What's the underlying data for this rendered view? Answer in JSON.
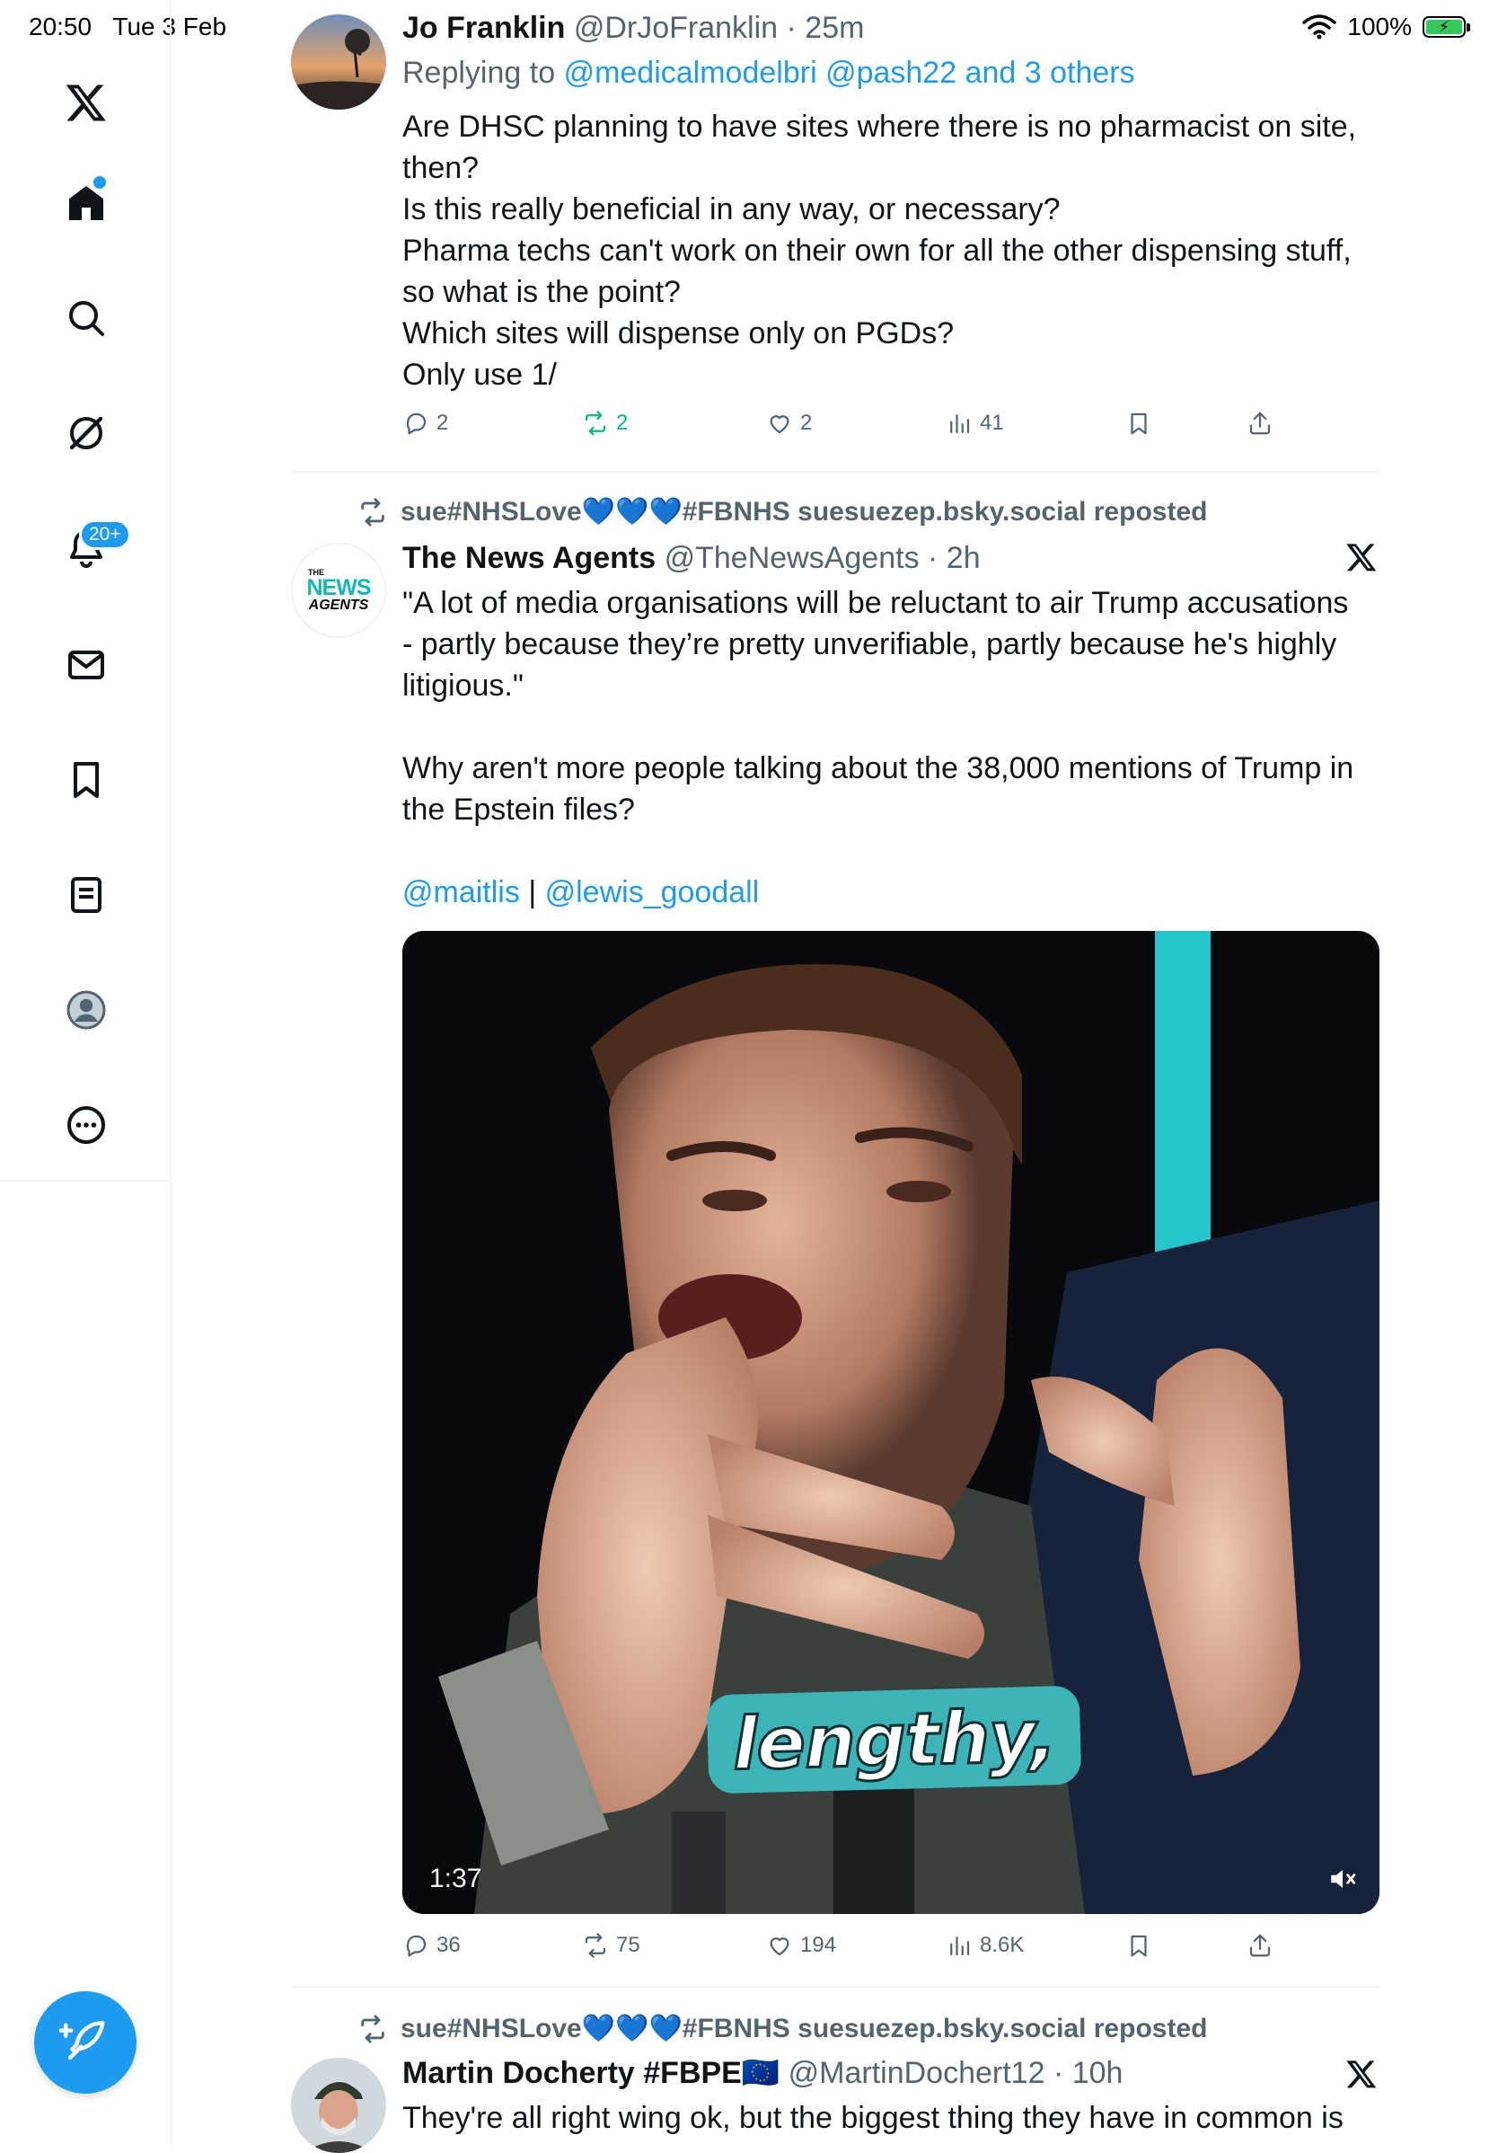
{
  "status_bar": {
    "time": "20:50",
    "date": "Tue 3 Feb",
    "battery": "100%",
    "battery_level_percent": 100
  },
  "sidebar": {
    "notifications_badge": "20+"
  },
  "posts": [
    {
      "name": "Jo Franklin",
      "handle": "@DrJoFranklin",
      "time": "25m",
      "replying_prefix": "Replying to",
      "replying_to": "@medicalmodelbri @pash22 and 3 others",
      "text_lines": [
        "Are DHSC planning to have sites where there is no pharmacist on site,",
        "then?",
        "Is this really beneficial in any way, or necessary?",
        "Pharma techs can't work on their own for all the other dispensing stuff,",
        "so what is the point?",
        "Which sites will dispense only on PGDs?",
        "Only use 1/"
      ],
      "stats": {
        "replies": "2",
        "reposts": "2",
        "likes": "2",
        "views": "41"
      }
    },
    {
      "reposted_by": "sue#NHSLove💙💙💙#FBNHS suesuezep.bsky.social reposted",
      "name": "The News Agents",
      "handle": "@TheNewsAgents",
      "time": "2h",
      "avatar_logo": [
        "THE",
        "NEWS",
        "AGENTS"
      ],
      "text_lines": [
        "\"A lot of media organisations will be reluctant to air Trump accusations",
        "- partly because they’re pretty unverifiable, partly because he's highly",
        "litigious.\"",
        "",
        "Why aren't more people talking about the 38,000 mentions of Trump in",
        "the Epstein files?",
        ""
      ],
      "mentions": [
        "@maitlis",
        "@lewis_goodall"
      ],
      "mention_separator": "|",
      "video": {
        "caption": "lengthy,",
        "duration": "1:37"
      },
      "stats": {
        "replies": "36",
        "reposts": "75",
        "likes": "194",
        "views": "8.6K"
      }
    },
    {
      "reposted_by": "sue#NHSLove💙💙💙#FBNHS suesuezep.bsky.social reposted",
      "name": "Martin Docherty #FBPE🇪🇺",
      "handle": "@MartinDochert12",
      "time": "10h",
      "text_lines": [
        "They're all right wing ok, but the biggest thing they have in common is"
      ]
    }
  ],
  "colors": {
    "accent": "#1d9bf0",
    "repost_green": "#00ba7c",
    "muted_text": "#536471",
    "divider": "#eff3f4"
  }
}
